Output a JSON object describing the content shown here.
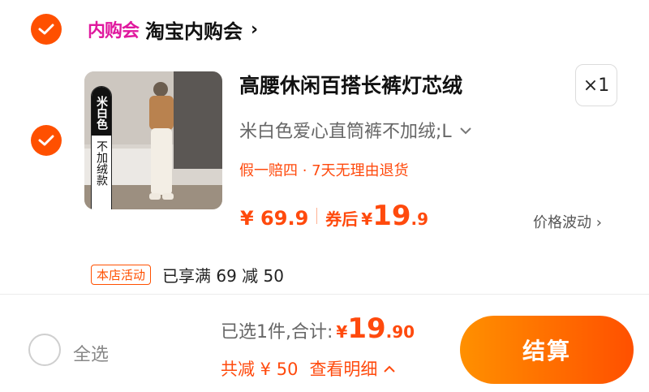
{
  "shop": {
    "logo_text": "内购会",
    "name": "淘宝内购会",
    "arrow": "›"
  },
  "item": {
    "image_badge_top": "米白色",
    "image_badge_bottom": "不加绒款",
    "title": "高腰休闲百搭长裤灯芯绒",
    "quantity": "×1",
    "sku": "米白色爱心直筒裤不加绒;L",
    "promise": "假一赔四 · 7天无理由退货",
    "price": "¥ 69.9",
    "coupon_label": "券后",
    "coupon_yen": "¥",
    "coupon_price_int": "19",
    "coupon_price_dec": ".9",
    "price_fluct": "价格波动 ›",
    "promo_tag": "本店活动",
    "promo_text": "已享满 69 减 50"
  },
  "footer": {
    "select_all": "全选",
    "selected_summary": "已选1件,合计:",
    "total_yen": "¥",
    "total_int": "19",
    "total_dec": ".90",
    "discount": "共减 ¥ 50",
    "detail": "查看明细",
    "detail_arrow": "^",
    "checkout": "结算"
  },
  "colors": {
    "accent": "#ff5000",
    "price": "#ff4a0d",
    "shop_logo": "#e0189e"
  }
}
